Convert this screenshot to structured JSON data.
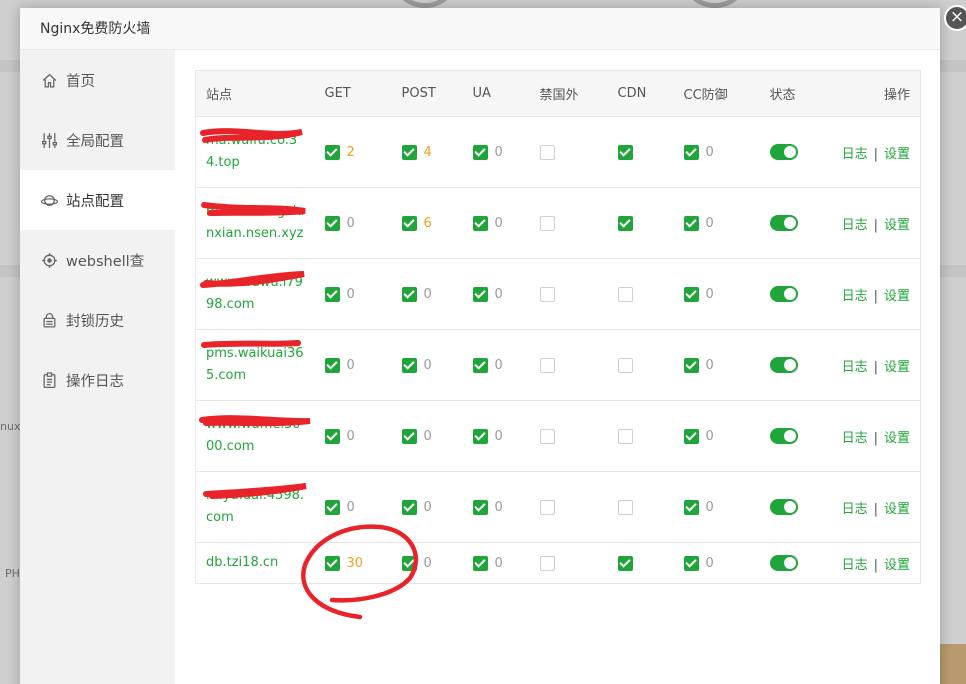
{
  "dialog": {
    "title": "Nginx免费防火墙",
    "close_label": "×"
  },
  "background": {
    "fragment_left_1": "nux",
    "fragment_left_2": "PH"
  },
  "sidebar": {
    "items": [
      {
        "label": "首页",
        "icon": "home-icon",
        "active": false
      },
      {
        "label": "全局配置",
        "icon": "sliders-icon",
        "active": false
      },
      {
        "label": "站点配置",
        "icon": "planet-icon",
        "active": true
      },
      {
        "label": "webshell查",
        "icon": "target-icon",
        "active": false
      },
      {
        "label": "封锁历史",
        "icon": "lock-history-icon",
        "active": false
      },
      {
        "label": "操作日志",
        "icon": "clipboard-icon",
        "active": false
      }
    ]
  },
  "table": {
    "headers": [
      "站点",
      "GET",
      "POST",
      "UA",
      "禁国外",
      "CDN",
      "CC防御",
      "状态",
      "操作"
    ],
    "log_label": "日志",
    "separator": "|",
    "settings_label": "设置",
    "rows": [
      {
        "site": "ma.waifu.co.34.top",
        "get": {
          "on": true,
          "count": "2"
        },
        "post": {
          "on": true,
          "count": "4"
        },
        "ua": {
          "on": true,
          "count": "0"
        },
        "block_foreign": false,
        "cdn": true,
        "cc": {
          "on": true,
          "count": "0"
        },
        "status": true
      },
      {
        "site": "m.sin.zhongxianxian.nsen.xyz",
        "get": {
          "on": true,
          "count": "0"
        },
        "post": {
          "on": true,
          "count": "6"
        },
        "ua": {
          "on": true,
          "count": "0"
        },
        "block_foreign": false,
        "cdn": true,
        "cc": {
          "on": true,
          "count": "0"
        },
        "status": true
      },
      {
        "site": "www.wuwu.i7998.com",
        "get": {
          "on": true,
          "count": "0"
        },
        "post": {
          "on": true,
          "count": "0"
        },
        "ua": {
          "on": true,
          "count": "0"
        },
        "block_foreign": false,
        "cdn": false,
        "cc": {
          "on": true,
          "count": "0"
        },
        "status": true
      },
      {
        "site": "pms.waikuai365.com",
        "get": {
          "on": true,
          "count": "0"
        },
        "post": {
          "on": true,
          "count": "0"
        },
        "ua": {
          "on": true,
          "count": "0"
        },
        "block_foreign": false,
        "cdn": false,
        "cc": {
          "on": true,
          "count": "0"
        },
        "status": true
      },
      {
        "site": "www.wumei3000.com",
        "get": {
          "on": true,
          "count": "0"
        },
        "post": {
          "on": true,
          "count": "0"
        },
        "ua": {
          "on": true,
          "count": "0"
        },
        "block_foreign": false,
        "cdn": false,
        "cc": {
          "on": true,
          "count": "0"
        },
        "status": true
      },
      {
        "site": "m.yu.dai.4598.com",
        "get": {
          "on": true,
          "count": "0"
        },
        "post": {
          "on": true,
          "count": "0"
        },
        "ua": {
          "on": true,
          "count": "0"
        },
        "block_foreign": false,
        "cdn": false,
        "cc": {
          "on": true,
          "count": "0"
        },
        "status": true
      },
      {
        "site": "db.tzi18.cn",
        "get": {
          "on": true,
          "count": "30"
        },
        "post": {
          "on": true,
          "count": "0"
        },
        "ua": {
          "on": true,
          "count": "0"
        },
        "block_foreign": false,
        "cdn": true,
        "cc": {
          "on": true,
          "count": "0"
        },
        "status": true
      }
    ]
  },
  "colors": {
    "accent": "#20a53a",
    "count_highlight": "#f0a020",
    "annotation": "#e8232a"
  }
}
